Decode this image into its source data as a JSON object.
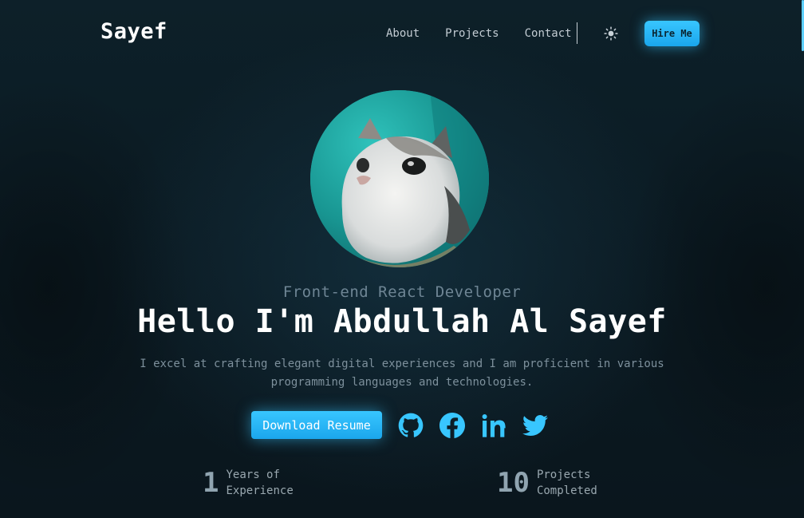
{
  "nav": {
    "logo": "Sayef",
    "links": [
      {
        "label": "About"
      },
      {
        "label": "Projects"
      },
      {
        "label": "Contact"
      }
    ],
    "theme_icon": "sun-icon",
    "hire_label": "Hire Me"
  },
  "hero": {
    "avatar": "cat-profile-photo",
    "role": "Front-end React Developer",
    "headline": "Hello I'm Abdullah Al Sayef",
    "description": "I excel at crafting elegant digital experiences and I am proficient in various programming languages and technologies.",
    "download_label": "Download Resume",
    "socials": [
      "github-icon",
      "facebook-icon",
      "linkedin-icon",
      "twitter-icon"
    ]
  },
  "stats": [
    {
      "value": "1",
      "line1": "Years of",
      "line2": "Experience"
    },
    {
      "value": "10",
      "line1": "Projects",
      "line2": "Completed"
    }
  ],
  "colors": {
    "accent": "#38c6ff",
    "background": "#0b1b24",
    "headline": "#ffffff",
    "muted": "#7d909c"
  }
}
